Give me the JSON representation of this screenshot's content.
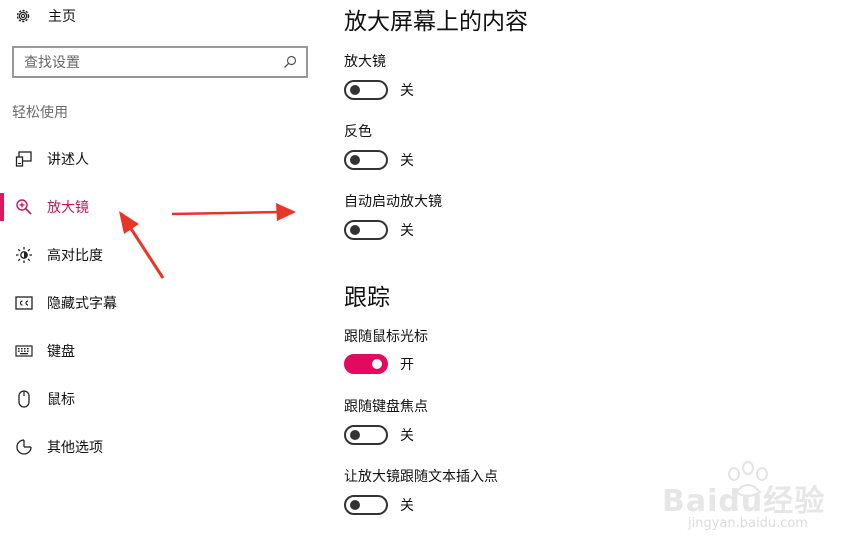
{
  "sidebar": {
    "home_label": "主页",
    "search_placeholder": "查找设置",
    "section_title": "轻松使用",
    "items": [
      {
        "label": "讲述人",
        "icon": "narrator-icon"
      },
      {
        "label": "放大镜",
        "icon": "magnifier-icon",
        "active": true
      },
      {
        "label": "高对比度",
        "icon": "high-contrast-icon"
      },
      {
        "label": "隐藏式字幕",
        "icon": "closed-captions-icon"
      },
      {
        "label": "键盘",
        "icon": "keyboard-icon"
      },
      {
        "label": "鼠标",
        "icon": "mouse-icon"
      },
      {
        "label": "其他选项",
        "icon": "other-options-icon"
      }
    ]
  },
  "main": {
    "title": "放大屏幕上的内容",
    "settings": [
      {
        "label": "放大镜",
        "state": "关",
        "on": false
      },
      {
        "label": "反色",
        "state": "关",
        "on": false
      },
      {
        "label": "自动启动放大镜",
        "state": "关",
        "on": false
      }
    ],
    "tracking_title": "跟踪",
    "tracking": [
      {
        "label": "跟随鼠标光标",
        "state": "开",
        "on": true
      },
      {
        "label": "跟随键盘焦点",
        "state": "关",
        "on": false
      },
      {
        "label": "让放大镜跟随文本插入点",
        "state": "关",
        "on": false
      }
    ]
  },
  "colors": {
    "accent": "#e2095f",
    "active_text": "#c2185b",
    "annotation_arrow": "#e8352a"
  },
  "watermark": {
    "brand": "Baidu经验",
    "site": "jingyan.baidu.com"
  }
}
